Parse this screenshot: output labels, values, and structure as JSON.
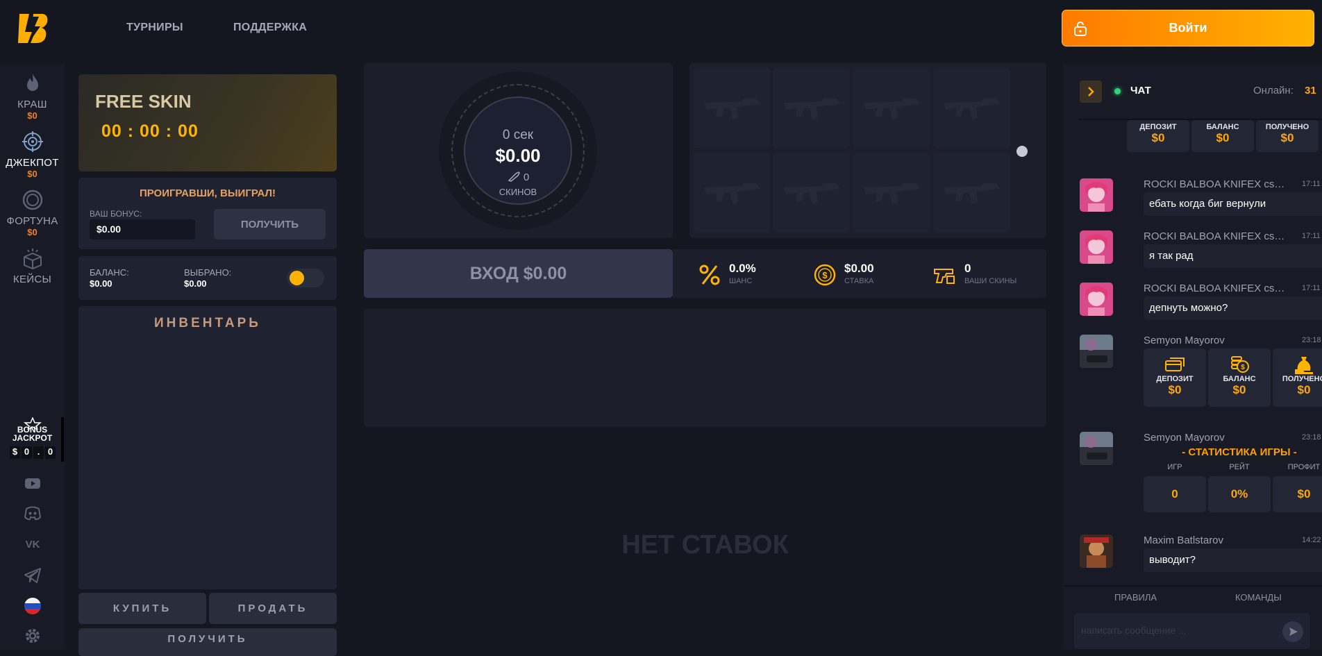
{
  "header": {
    "nav": [
      "ТУРНИРЫ",
      "ПОДДЕРЖКА"
    ],
    "login_label": "Войти"
  },
  "sidebar": {
    "items": [
      {
        "label": "КРАШ",
        "value": "$0"
      },
      {
        "label": "ДЖЕКПОТ",
        "value": "$0"
      },
      {
        "label": "ФОРТУНА",
        "value": "$0"
      },
      {
        "label": "КЕЙСЫ"
      }
    ],
    "bonus_jackpot": {
      "line1": "BONUS",
      "line2": "JACKPOT",
      "digits": [
        "$",
        "0",
        ".",
        "0"
      ]
    }
  },
  "free_skin": {
    "title": "FREE SKIN",
    "timer": "00 : 00 : 00"
  },
  "bonus": {
    "heading": "ПРОИГРАВШИ, ВЫИГРАЛ!",
    "label": "ВАШ БОНУС:",
    "value": "$0.00",
    "button": "ПОЛУЧИТЬ"
  },
  "balance": {
    "balance_label": "БАЛАНС:",
    "balance_value": "$0.00",
    "selected_label": "ВЫБРАНО:",
    "selected_value": "$0.00"
  },
  "inventory": {
    "title": "ИНВЕНТАРЬ",
    "buy": "КУПИТЬ",
    "sell": "ПРОДАТЬ",
    "get": "ПОЛУЧИТЬ"
  },
  "round": {
    "timer": "0 сек",
    "amount": "$0.00",
    "skins_count": "0",
    "skins_label": "СКИНОВ"
  },
  "enter_button": "ВХОД $0.00",
  "stats": [
    {
      "value": "0.0%",
      "label": "ШАНС"
    },
    {
      "value": "$0.00",
      "label": "СТАВКА"
    },
    {
      "value": "0",
      "label": "ВАШИ СКИНЫ"
    }
  ],
  "no_bets": "НЕТ СТАВОК",
  "chat": {
    "title": "ЧАТ",
    "online_label": "Онлайн:",
    "online_count": "31",
    "top_card": [
      {
        "label": "ДЕПОЗИТ",
        "value": "$0"
      },
      {
        "label": "БАЛАНС",
        "value": "$0"
      },
      {
        "label": "ПОЛУЧЕНО",
        "value": "$0"
      }
    ],
    "messages": [
      {
        "name": "ROCKI BALBOA KNIFEX csgo",
        "time": "17:11",
        "text": "ебать когда биг вернули"
      },
      {
        "name": "ROCKI BALBOA KNIFEX csgo",
        "time": "17:11",
        "text": "я так рад"
      },
      {
        "name": "ROCKI BALBOA KNIFEX csgo",
        "time": "17:11",
        "text": "депнуть можно?"
      },
      {
        "name": "Semyon Mayorov",
        "time": "23:18",
        "card": [
          {
            "label": "ДЕПОЗИТ",
            "value": "$0"
          },
          {
            "label": "БАЛАНС",
            "value": "$0"
          },
          {
            "label": "ПОЛУЧЕНО",
            "value": "$0"
          }
        ]
      },
      {
        "name": "Semyon Mayorov",
        "time": "23:18",
        "stats_title": "- СТАТИСТИКА ИГРЫ -",
        "stats": [
          {
            "label": "ИГР",
            "value": "0"
          },
          {
            "label": "РЕЙТ",
            "value": "0%"
          },
          {
            "label": "ПРОФИТ",
            "value": "$0"
          }
        ]
      },
      {
        "name": "Maxim Batlstarov",
        "time": "14:22",
        "text": "выводит?"
      }
    ],
    "footer": {
      "rules": "ПРАВИЛА",
      "commands": "КОМАНДЫ",
      "input_placeholder": "написать сообщение ..."
    }
  },
  "colors": {
    "accent": "#ffa800",
    "login_gradient_start": "#ff7a00",
    "login_gradient_end": "#ffb200",
    "background": "#141620",
    "panel": "#1f2230"
  }
}
